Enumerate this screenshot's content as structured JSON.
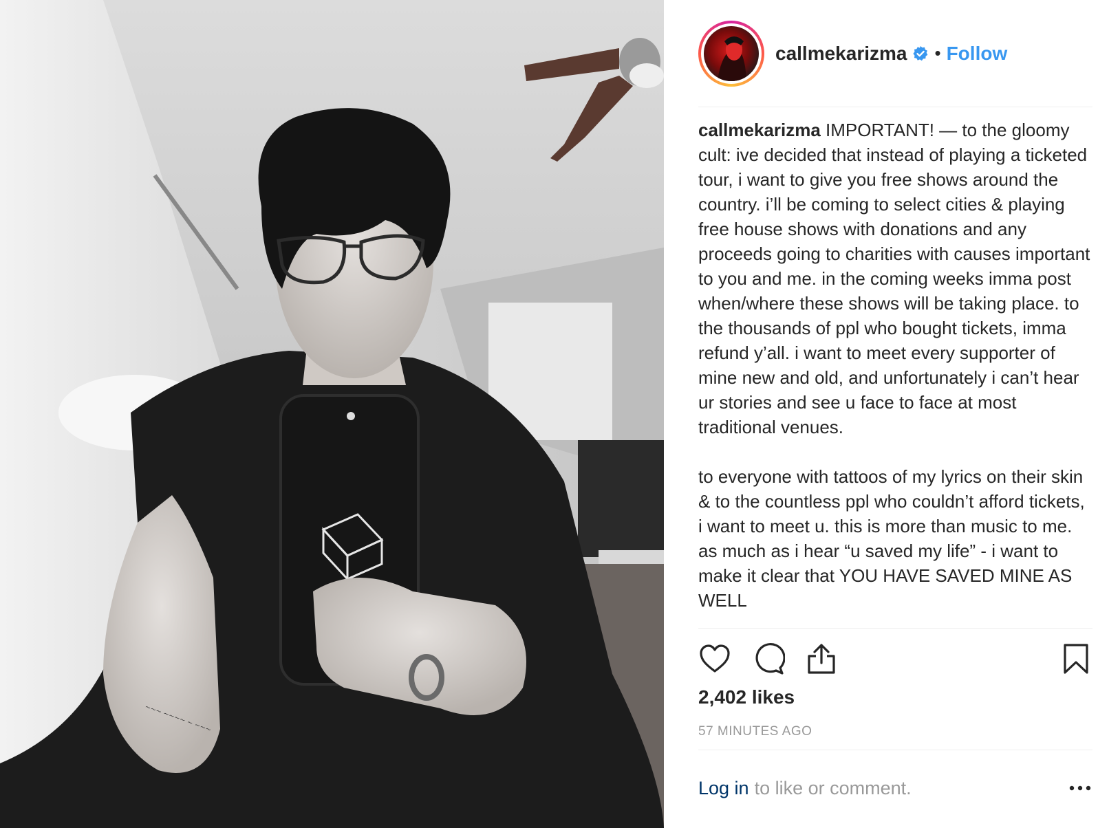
{
  "post": {
    "username": "callmekarizma",
    "follow_label": "Follow",
    "dot": "•",
    "caption_text": " IMPORTANT! — to the gloomy cult: ive decided that instead of playing a ticketed tour, i want to give you free shows around the country. i’ll be coming to select cities & playing free house shows with donations and any proceeds going to charities with causes important to you and me. in the coming weeks imma post when/where these shows will be taking place. to the thousands of ppl who bought tickets, imma refund y’all. i want to meet every supporter of mine new and old, and unfortunately i can’t hear ur stories and see u face to face at most traditional venues.\n\nto everyone with tattoos of my lyrics on their skin & to the countless ppl who couldn’t afford tickets, i want to meet u. this is more than music to me. as much as i hear “u saved my life” - i want to make it clear that YOU HAVE SAVED MINE AS WELL",
    "likes": "2,402 likes",
    "time_ago": "57 MINUTES AGO"
  },
  "footer": {
    "login_label": "Log in",
    "rest_label": "to like or comment."
  },
  "icons": {
    "like": "heart-icon",
    "comment": "comment-icon",
    "share": "share-icon",
    "save": "bookmark-icon",
    "more": "more-options-icon",
    "verified": "verified-badge-icon"
  },
  "colors": {
    "link_blue": "#3897f0",
    "login_blue": "#003569",
    "muted_gray": "#999999",
    "text": "#262626"
  }
}
